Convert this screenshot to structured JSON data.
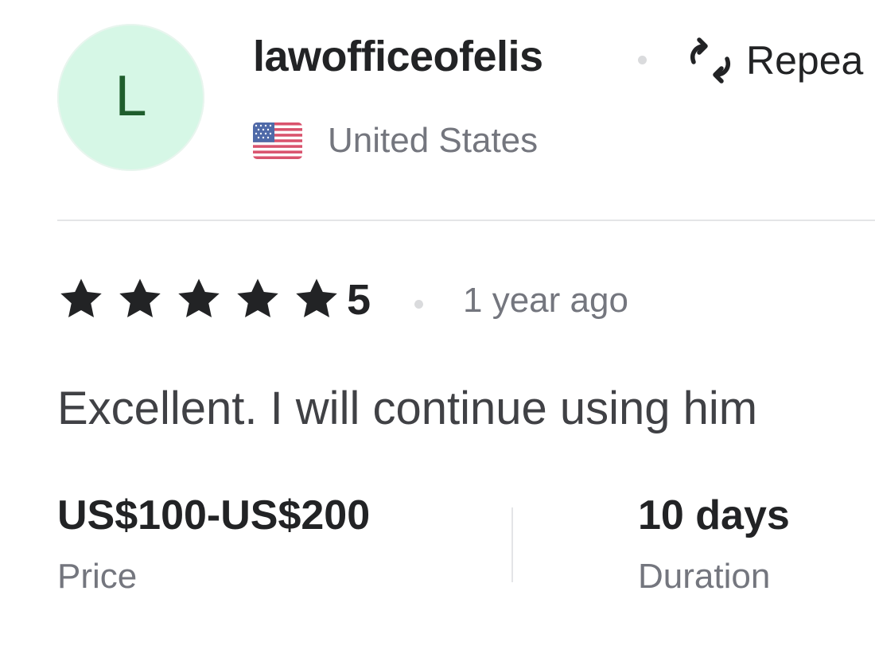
{
  "reviewer": {
    "avatar_letter": "L",
    "username": "lawofficeofelis",
    "repeat_label": "Repea",
    "country": "United States",
    "flag_icon": "us-flag-icon"
  },
  "review": {
    "rating": "5",
    "stars_filled": 5,
    "stars_total": 5,
    "time_ago": "1 year ago",
    "text": "Excellent. I will continue using him"
  },
  "details": {
    "price_value": "US$100-US$200",
    "price_label": "Price",
    "duration_value": "10 days",
    "duration_label": "Duration"
  },
  "colors": {
    "avatar_bg": "#d6f7e6",
    "avatar_letter": "#1f5e2d",
    "text_primary": "#222325",
    "text_secondary": "#74767e",
    "divider": "#e4e5e7"
  }
}
